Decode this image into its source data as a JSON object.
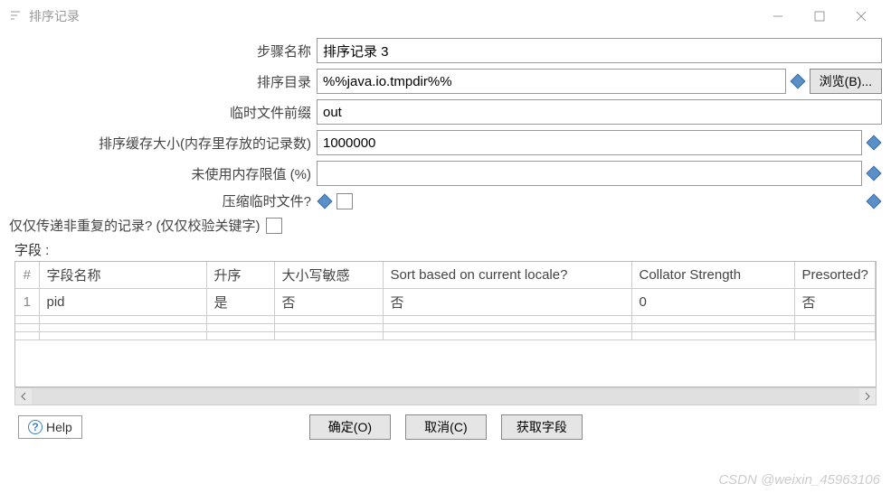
{
  "window": {
    "title": "排序记录"
  },
  "form": {
    "step_name_label": "步骤名称",
    "step_name_value": "排序记录 3",
    "sort_dir_label": "排序目录",
    "sort_dir_value": "%%java.io.tmpdir%%",
    "browse_btn": "浏览(B)...",
    "tmp_prefix_label": "临时文件前缀",
    "tmp_prefix_value": "out",
    "cache_size_label": "排序缓存大小(内存里存放的记录数)",
    "cache_size_value": "1000000",
    "free_mem_label": "未使用内存限值 (%)",
    "free_mem_value": "",
    "compress_label": "压缩临时文件?",
    "unique_label": "仅仅传递非重复的记录? (仅仅校验关键字)"
  },
  "fields_section_label": "字段 :",
  "table": {
    "headers": {
      "idx": "#",
      "field_name": "字段名称",
      "ascending": "升序",
      "case_sensitive": "大小写敏感",
      "locale_sort": "Sort based on current locale?",
      "collator_strength": "Collator Strength",
      "presorted": "Presorted?"
    },
    "rows": [
      {
        "idx": "1",
        "field_name": "pid",
        "ascending": "是",
        "case_sensitive": "否",
        "locale_sort": "否",
        "collator_strength": "0",
        "presorted": "否"
      }
    ]
  },
  "footer": {
    "help": "Help",
    "ok": "确定(O)",
    "cancel": "取消(C)",
    "get_fields": "获取字段"
  },
  "watermark": "CSDN @weixin_45963106"
}
